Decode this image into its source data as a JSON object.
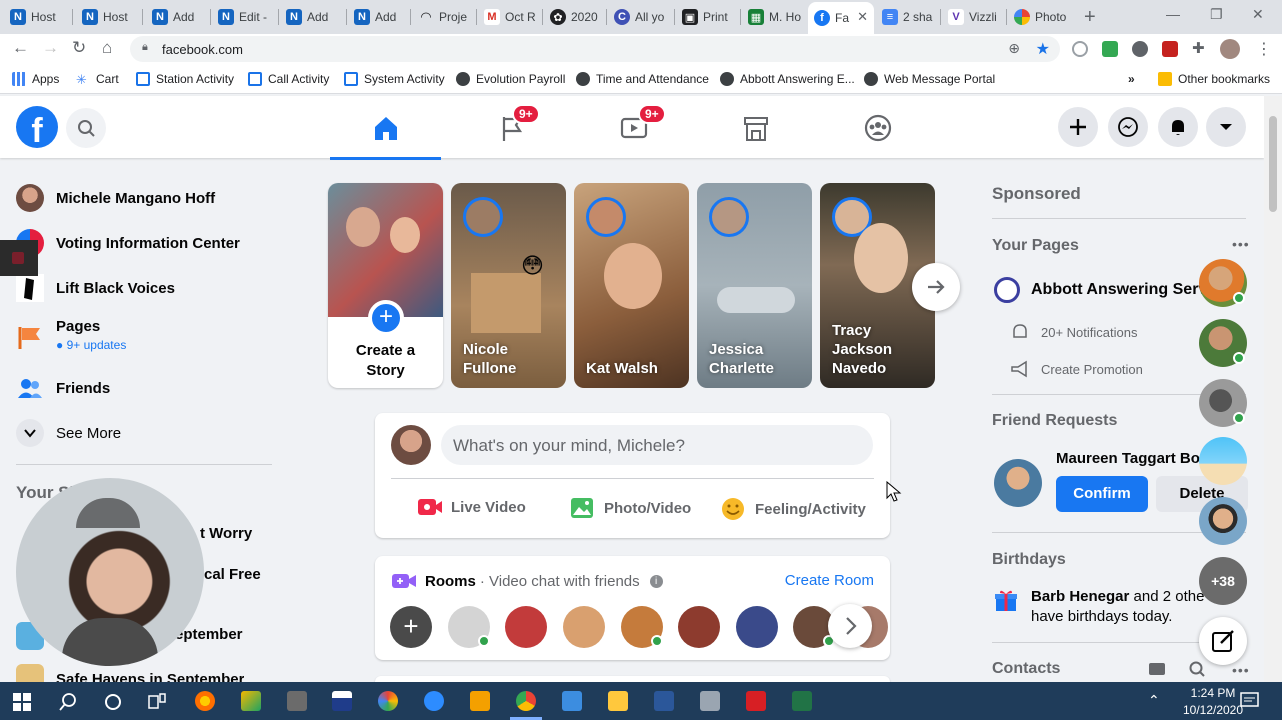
{
  "browser": {
    "tabs": [
      {
        "label": "Host",
        "icon": "n-icon",
        "color": "#1565c0"
      },
      {
        "label": "Host",
        "icon": "n-icon",
        "color": "#1565c0"
      },
      {
        "label": "Add",
        "icon": "n-icon",
        "color": "#1565c0"
      },
      {
        "label": "Edit -",
        "icon": "n-icon",
        "color": "#1565c0"
      },
      {
        "label": "Add",
        "icon": "n-icon",
        "color": "#1565c0"
      },
      {
        "label": "Add",
        "icon": "n-icon",
        "color": "#1565c0"
      },
      {
        "label": "Proje",
        "icon": "wifi-icon",
        "color": "#202124"
      },
      {
        "label": "Oct R",
        "icon": "gmail-icon",
        "color": "#d93025"
      },
      {
        "label": "2020",
        "icon": "paw-icon",
        "color": "#202124"
      },
      {
        "label": "All yo",
        "icon": "c-icon",
        "color": "#3f51b5"
      },
      {
        "label": "Print",
        "icon": "print-icon",
        "color": "#202124"
      },
      {
        "label": "M. Ho",
        "icon": "sheets-icon",
        "color": "#188038"
      },
      {
        "label": "Fa",
        "icon": "facebook-icon",
        "color": "#1877f2"
      },
      {
        "label": "2 sha",
        "icon": "docs-icon",
        "color": "#4285f4"
      },
      {
        "label": "Vizzli",
        "icon": "v-icon",
        "color": "#5e35b1"
      },
      {
        "label": "Photo",
        "icon": "photos-icon",
        "color": "#ea4335"
      }
    ],
    "url": "facebook.com",
    "bookmarks": [
      {
        "label": "Apps"
      },
      {
        "label": "Cart"
      },
      {
        "label": "Station Activity"
      },
      {
        "label": "Call Activity"
      },
      {
        "label": "System Activity"
      },
      {
        "label": "Evolution Payroll"
      },
      {
        "label": "Time and Attendance"
      },
      {
        "label": "Abbott Answering E..."
      },
      {
        "label": "Web Message Portal"
      },
      {
        "label": "Other bookmarks"
      }
    ],
    "more_bookmarks": "»"
  },
  "header": {
    "logo": "f",
    "badges": {
      "watch": "9+",
      "pages": "9+"
    }
  },
  "sidebar": {
    "items": [
      {
        "label": "Michele Mangano Hoff"
      },
      {
        "label": "Voting Information Center"
      },
      {
        "label": "Lift Black Voices"
      },
      {
        "label": "Pages",
        "sub": "9+ updates"
      },
      {
        "label": "Friends"
      },
      {
        "label": "See More"
      }
    ],
    "shortcuts_title": "Your Sh",
    "shortcuts": [
      "t Worry",
      "cal Free",
      "eptember",
      "Safe Havens in September"
    ]
  },
  "stories": [
    {
      "name": "Create a Story"
    },
    {
      "name": "Nicole Fullone"
    },
    {
      "name": "Kat Walsh"
    },
    {
      "name": "Jessica Charlette"
    },
    {
      "name": "Tracy Jackson Navedo"
    }
  ],
  "composer": {
    "placeholder": "What's on your mind, Michele?",
    "live": "Live Video",
    "photo": "Photo/Video",
    "feeling": "Feeling/Activity"
  },
  "rooms": {
    "title": "Rooms",
    "subtitle": "· Video chat with friends",
    "create": "Create Room"
  },
  "right": {
    "sponsored": "Sponsored",
    "your_pages": "Your Pages",
    "page_name": "Abbott Answering Servi",
    "notifications": "20+ Notifications",
    "promotion": "Create Promotion",
    "friend_requests": "Friend Requests",
    "requester": "Maureen Taggart Bo",
    "confirm": "Confirm",
    "delete": "Delete",
    "birthdays": "Birthdays",
    "birthday_name": "Barb Henegar",
    "birthday_rest": " and 2 othe",
    "birthday_line2": "have birthdays today.",
    "contacts": "Contacts",
    "more_chats": "+38"
  },
  "taskbar": {
    "time": "1:24 PM",
    "date": "10/12/2020"
  }
}
